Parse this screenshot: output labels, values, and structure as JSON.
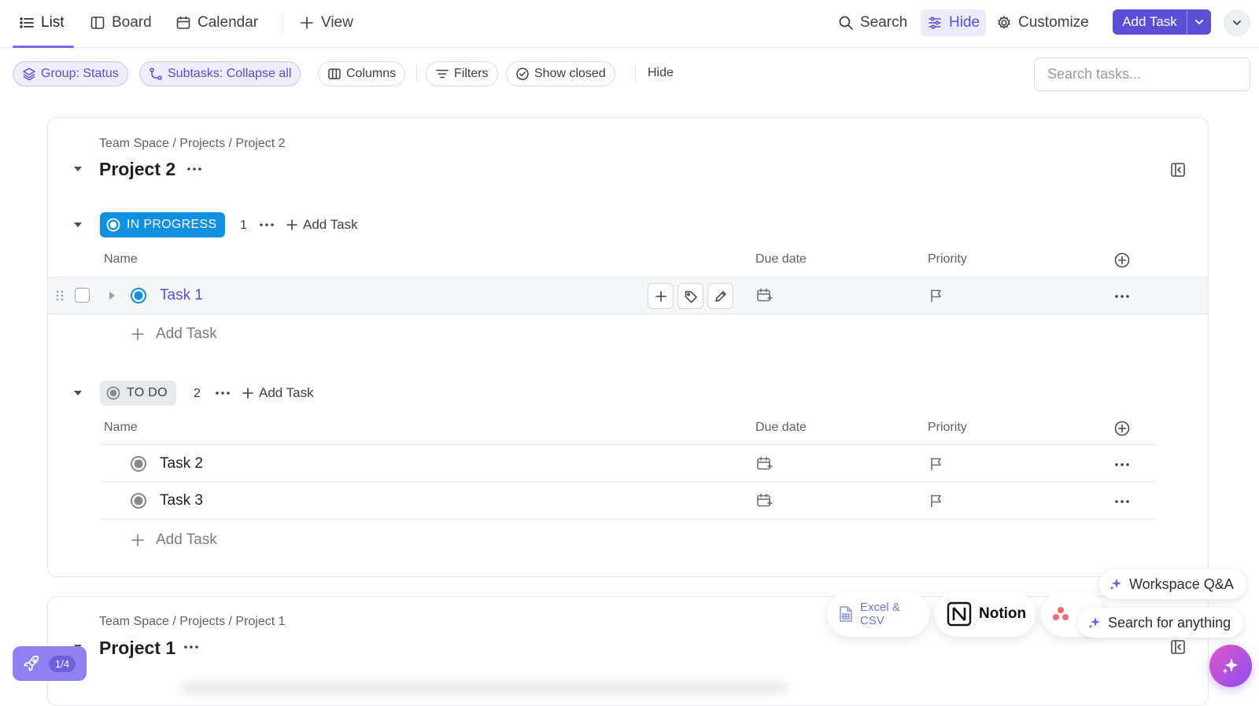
{
  "topbar": {
    "tabs": [
      {
        "label": "List",
        "icon": "list-icon"
      },
      {
        "label": "Board",
        "icon": "board-icon"
      },
      {
        "label": "Calendar",
        "icon": "calendar-icon"
      }
    ],
    "add_view_label": "View",
    "search_label": "Search",
    "hide_label": "Hide",
    "customize_label": "Customize",
    "add_task_label": "Add Task"
  },
  "filterbar": {
    "group_label": "Group: Status",
    "subtasks_label": "Subtasks: Collapse all",
    "columns_label": "Columns",
    "filters_label": "Filters",
    "show_closed_label": "Show closed",
    "hide_label": "Hide",
    "search_placeholder": "Search tasks..."
  },
  "projects": [
    {
      "breadcrumb": "Team Space / Projects / Project 2",
      "title": "Project 2",
      "groups": [
        {
          "status": "IN PROGRESS",
          "count": "1",
          "add_label": "Add Task",
          "columns": {
            "name": "Name",
            "due": "Due date",
            "priority": "Priority"
          },
          "tasks": [
            {
              "name": "Task 1"
            }
          ],
          "add_row_label": "Add Task"
        },
        {
          "status": "TO DO",
          "count": "2",
          "add_label": "Add Task",
          "columns": {
            "name": "Name",
            "due": "Due date",
            "priority": "Priority"
          },
          "tasks": [
            {
              "name": "Task 2"
            },
            {
              "name": "Task 3"
            }
          ],
          "add_row_label": "Add Task"
        }
      ]
    },
    {
      "breadcrumb": "Team Space / Projects / Project 1",
      "title": "Project 1"
    }
  ],
  "overlays": {
    "import_excel_label": "Excel & CSV",
    "import_notion_label": "Notion",
    "workspace_qa_label": "Workspace Q&A",
    "search_anything_label": "Search for anything",
    "onboarding_progress": "1/4"
  },
  "colors": {
    "accent": "#5b4fd8",
    "in_progress": "#1090e0",
    "todo": "#87898f"
  }
}
